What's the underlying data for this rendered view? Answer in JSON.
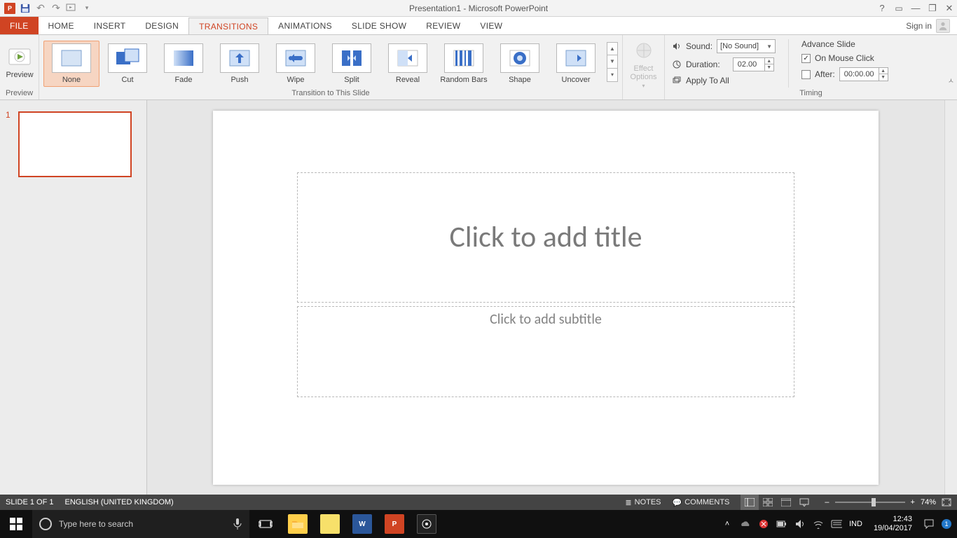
{
  "title": "Presentation1 - Microsoft PowerPoint",
  "qat": {
    "undo": "↶",
    "redo": "↷"
  },
  "sys": {
    "help": "?",
    "ropts": "▭",
    "min": "—",
    "restore": "❐",
    "close": "✕"
  },
  "tabs": {
    "file": "FILE",
    "home": "HOME",
    "insert": "INSERT",
    "design": "DESIGN",
    "transitions": "TRANSITIONS",
    "animations": "ANIMATIONS",
    "slideshow": "SLIDE SHOW",
    "review": "REVIEW",
    "view": "VIEW",
    "signin": "Sign in"
  },
  "ribbon": {
    "preview": {
      "btn": "Preview",
      "group": "Preview"
    },
    "gallery": {
      "group": "Transition to This Slide",
      "items": [
        {
          "name": "None"
        },
        {
          "name": "Cut"
        },
        {
          "name": "Fade"
        },
        {
          "name": "Push"
        },
        {
          "name": "Wipe"
        },
        {
          "name": "Split"
        },
        {
          "name": "Reveal"
        },
        {
          "name": "Random Bars"
        },
        {
          "name": "Shape"
        },
        {
          "name": "Uncover"
        }
      ]
    },
    "effect": {
      "line1": "Effect",
      "line2": "Options"
    },
    "timing": {
      "group": "Timing",
      "sound_label": "Sound:",
      "sound_value": "[No Sound]",
      "duration_label": "Duration:",
      "duration_value": "02.00",
      "apply_all": "Apply To All",
      "advance_title": "Advance Slide",
      "mouse_click": "On Mouse Click",
      "after_label": "After:",
      "after_value": "00:00.00"
    }
  },
  "slide": {
    "num": "1",
    "title_placeholder": "Click to add title",
    "subtitle_placeholder": "Click to add subtitle"
  },
  "status": {
    "slide_info": "SLIDE 1 OF 1",
    "language": "ENGLISH (UNITED KINGDOM)",
    "notes": "NOTES",
    "comments": "COMMENTS",
    "zoom": "74%"
  },
  "taskbar": {
    "search_placeholder": "Type here to search",
    "lang": "IND",
    "time": "12:43",
    "date": "19/04/2017"
  }
}
